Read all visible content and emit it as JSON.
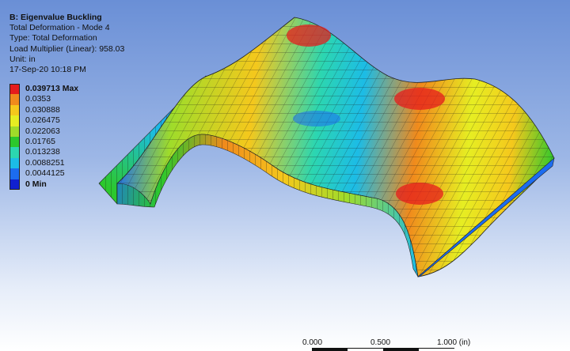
{
  "plot": {
    "title": "B: Eigenvalue Buckling",
    "line1": "Total Deformation - Mode 4",
    "line2": "Type: Total Deformation",
    "line3": "Load Multiplier (Linear): 958.03",
    "line4": "Unit: in",
    "line5": "17-Sep-20 10:18 PM"
  },
  "legend": {
    "entries": [
      {
        "label": "0.039713 Max",
        "color": "#e61c1c"
      },
      {
        "label": "0.0353",
        "color": "#f08a1c"
      },
      {
        "label": "0.030888",
        "color": "#f5c81c"
      },
      {
        "label": "0.026475",
        "color": "#e6ee22"
      },
      {
        "label": "0.022063",
        "color": "#9fdc2a"
      },
      {
        "label": "0.01765",
        "color": "#2cc82c"
      },
      {
        "label": "0.013238",
        "color": "#2cd6b0"
      },
      {
        "label": "0.0088251",
        "color": "#1cbce6"
      },
      {
        "label": "0.0044125",
        "color": "#1c6cf0"
      },
      {
        "label": "0 Min",
        "color": "#1020d0"
      }
    ]
  },
  "scale": {
    "label_start": "0.000",
    "label_mid": "0.500",
    "label_end": "1.000 (in)"
  }
}
